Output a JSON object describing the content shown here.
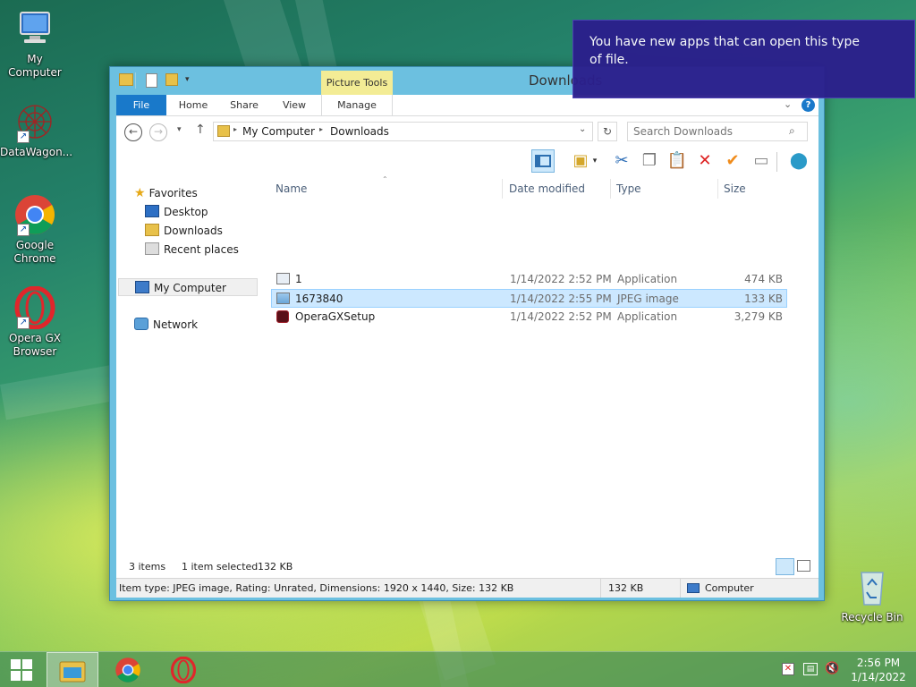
{
  "desktop": {
    "icons": [
      {
        "label": "My Computer"
      },
      {
        "label": "DataWagon..."
      },
      {
        "label": "Google Chrome"
      },
      {
        "label": "Opera GX Browser"
      },
      {
        "label": "Recycle Bin"
      }
    ]
  },
  "window": {
    "title": "Downloads",
    "contextual_tab_group": "Picture Tools",
    "tabs": [
      "File",
      "Home",
      "Share",
      "View",
      "Manage"
    ],
    "address": {
      "crumbs": [
        "My Computer",
        "Downloads"
      ]
    },
    "search": {
      "placeholder": "Search Downloads"
    },
    "nav": {
      "favorites": "Favorites",
      "favorites_items": [
        "Desktop",
        "Downloads",
        "Recent places"
      ],
      "computer": "My Computer",
      "network": "Network"
    },
    "columns": [
      "Name",
      "Date modified",
      "Type",
      "Size"
    ],
    "files": [
      {
        "name": "1",
        "date": "1/14/2022 2:52 PM",
        "type": "Application",
        "size": "474 KB"
      },
      {
        "name": "1673840",
        "date": "1/14/2022 2:55 PM",
        "type": "JPEG image",
        "size": "133 KB"
      },
      {
        "name": "OperaGXSetup",
        "date": "1/14/2022 2:52 PM",
        "type": "Application",
        "size": "3,279 KB"
      }
    ],
    "status": {
      "items": "3 items",
      "selected": "1 item selected",
      "selected_size": "132 KB"
    },
    "details": {
      "info": "Item type: JPEG image, Rating: Unrated, Dimensions: 1920 x 1440, Size: 132 KB",
      "size": "132 KB",
      "location": "Computer"
    }
  },
  "notification": {
    "text": "You have new apps that can open this type of file."
  },
  "taskbar": {
    "time": "2:56 PM",
    "date": "1/14/2022"
  }
}
